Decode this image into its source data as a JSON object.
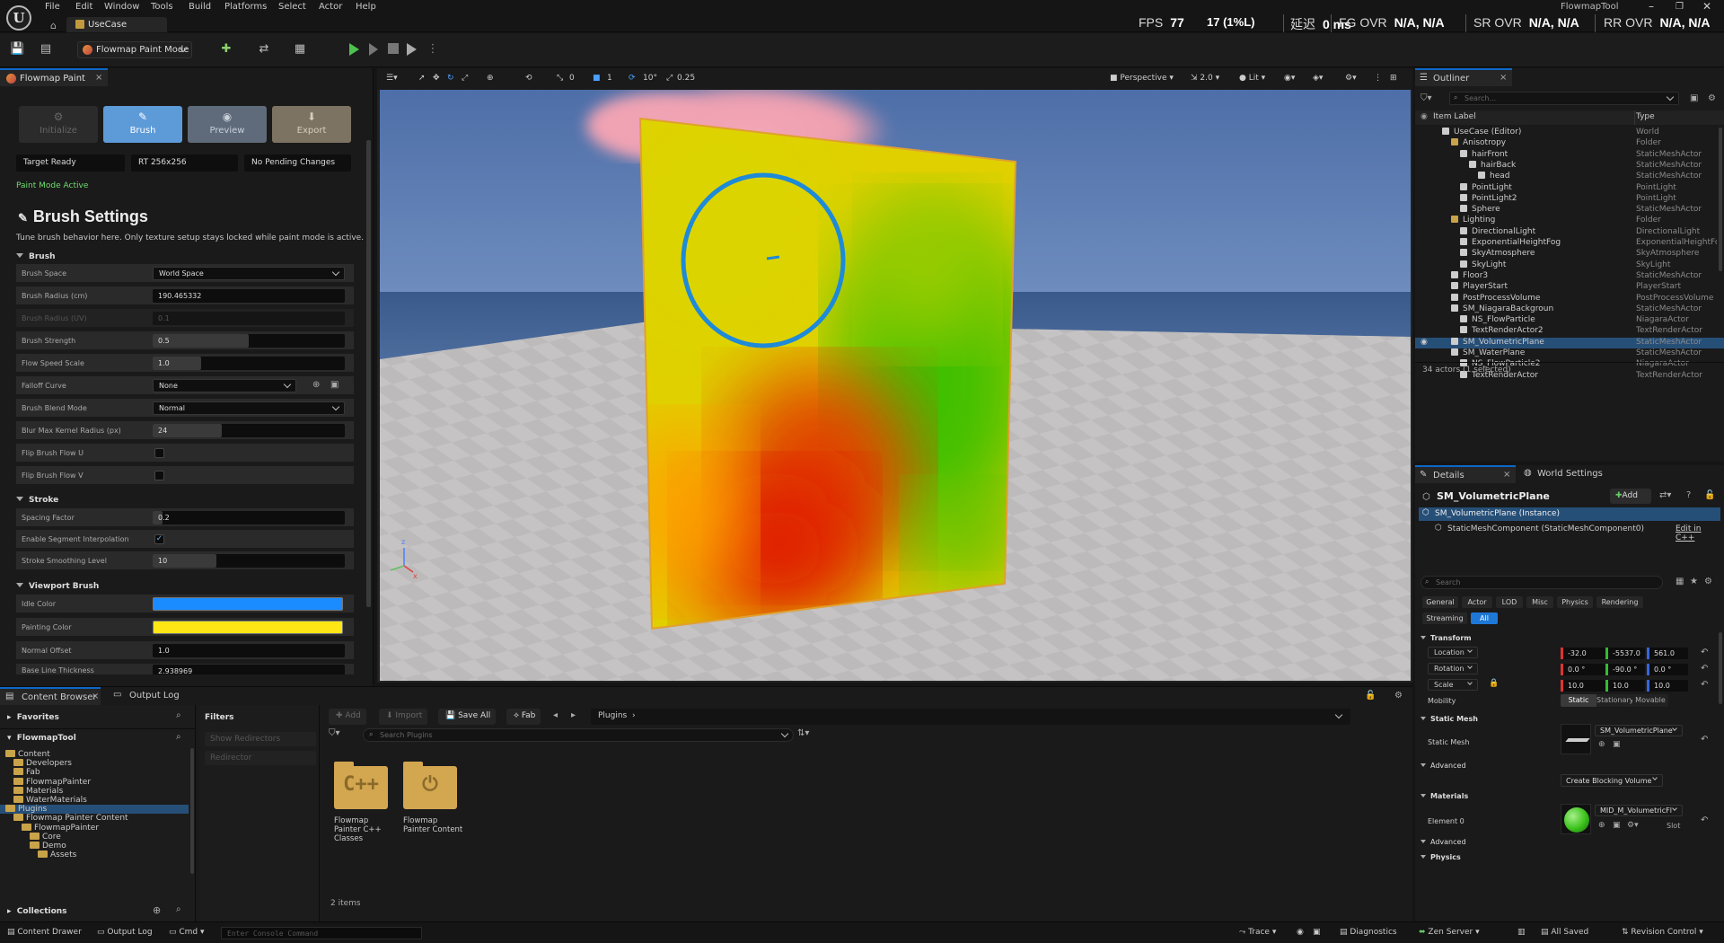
{
  "menu": [
    "File",
    "Edit",
    "Window",
    "Tools",
    "Build",
    "Platforms",
    "Select",
    "Actor",
    "Help"
  ],
  "doc_tab": "UseCase",
  "project_name": "FlowmapTool",
  "stats": {
    "fps_label": "FPS",
    "fps": "77",
    "ms": "17 (1%L)",
    "latency_label": "延迟",
    "latency": "0 ms",
    "fg_label": "FG OVR",
    "fg": "N/A, N/A",
    "sr_label": "SR OVR",
    "sr": "N/A, N/A",
    "rr_label": "RR OVR",
    "rr": "N/A, N/A"
  },
  "toolbar": {
    "mode": "Flowmap Paint Mode"
  },
  "left_panel": {
    "tab": "Flowmap Paint",
    "modes": [
      {
        "label": "Initialize",
        "glyph": "⚙"
      },
      {
        "label": "Brush",
        "glyph": "✎"
      },
      {
        "label": "Preview",
        "glyph": "◉"
      },
      {
        "label": "Export",
        "glyph": "⬇"
      }
    ],
    "pills": [
      "Target Ready",
      "RT 256x256",
      "No Pending Changes"
    ],
    "status": "Paint Mode Active",
    "title": "Brush Settings",
    "desc": "Tune brush behavior here. Only texture setup stays locked while paint mode is active.",
    "sections": {
      "brush": "Brush",
      "stroke": "Stroke",
      "viewport": "Viewport Brush"
    },
    "rows": {
      "brush_space": {
        "label": "Brush Space",
        "value": "World Space"
      },
      "brush_radius": {
        "label": "Brush Radius (cm)",
        "value": "190.465332"
      },
      "brush_radius_uv": {
        "label": "Brush Radius (UV)",
        "value": "0.1"
      },
      "brush_strength": {
        "label": "Brush Strength",
        "value": "0.5",
        "fill": 0.5
      },
      "flow_speed": {
        "label": "Flow Speed Scale",
        "value": "1.0",
        "fill": 0.25
      },
      "falloff": {
        "label": "Falloff Curve",
        "value": "None"
      },
      "blend": {
        "label": "Brush Blend Mode",
        "value": "Normal"
      },
      "blur": {
        "label": "Blur Max Kernel Radius (px)",
        "value": "24",
        "fill": 0.36
      },
      "flip_u": {
        "label": "Flip Brush Flow U",
        "checked": false
      },
      "flip_v": {
        "label": "Flip Brush Flow V",
        "checked": false
      },
      "spacing": {
        "label": "Spacing Factor",
        "value": "0.2",
        "fill": 0.05
      },
      "segment": {
        "label": "Enable Segment Interpolation",
        "checked": true
      },
      "smoothing": {
        "label": "Stroke Smoothing Level",
        "value": "10",
        "fill": 0.33
      },
      "idle_color": {
        "label": "Idle Color",
        "color": "#1a8cff"
      },
      "paint_color": {
        "label": "Painting Color",
        "color": "#ffe614"
      },
      "normal_offset": {
        "label": "Normal Offset",
        "value": "1.0"
      },
      "line_thickness": {
        "label": "Base Line Thickness",
        "value": "2.938969"
      }
    }
  },
  "viewport": {
    "perspective": "Perspective",
    "lit": "Lit",
    "grid_vals": [
      "0",
      "1",
      "10°",
      "0.25"
    ],
    "cam_speed": "2.0"
  },
  "outliner": {
    "tab": "Outliner",
    "search": "Search...",
    "col_label": "Item Label",
    "col_type": "Type",
    "items": [
      {
        "name": "UseCase (Editor)",
        "type": "World",
        "indent": 0
      },
      {
        "name": "Anisotropy",
        "type": "Folder",
        "indent": 1
      },
      {
        "name": "hairFront",
        "type": "StaticMeshActor",
        "indent": 2
      },
      {
        "name": "hairBack",
        "type": "StaticMeshActor",
        "indent": 3
      },
      {
        "name": "head",
        "type": "StaticMeshActor",
        "indent": 4
      },
      {
        "name": "PointLight",
        "type": "PointLight",
        "indent": 2
      },
      {
        "name": "PointLight2",
        "type": "PointLight",
        "indent": 2
      },
      {
        "name": "Sphere",
        "type": "StaticMeshActor",
        "indent": 2
      },
      {
        "name": "Lighting",
        "type": "Folder",
        "indent": 1
      },
      {
        "name": "DirectionalLight",
        "type": "DirectionalLight",
        "indent": 2
      },
      {
        "name": "ExponentialHeightFog",
        "type": "ExponentialHeightFog",
        "indent": 2
      },
      {
        "name": "SkyAtmosphere",
        "type": "SkyAtmosphere",
        "indent": 2
      },
      {
        "name": "SkyLight",
        "type": "SkyLight",
        "indent": 2
      },
      {
        "name": "Floor3",
        "type": "StaticMeshActor",
        "indent": 1
      },
      {
        "name": "PlayerStart",
        "type": "PlayerStart",
        "indent": 1
      },
      {
        "name": "PostProcessVolume",
        "type": "PostProcessVolume",
        "indent": 1
      },
      {
        "name": "SM_NiagaraBackgroun",
        "type": "StaticMeshActor",
        "indent": 1
      },
      {
        "name": "NS_FlowParticle",
        "type": "NiagaraActor",
        "indent": 2
      },
      {
        "name": "TextRenderActor2",
        "type": "TextRenderActor",
        "indent": 2
      },
      {
        "name": "SM_VolumetricPlane",
        "type": "StaticMeshActor",
        "indent": 1,
        "selected": true
      },
      {
        "name": "SM_WaterPlane",
        "type": "StaticMeshActor",
        "indent": 1
      },
      {
        "name": "NS_FlowParticle2",
        "type": "NiagaraActor",
        "indent": 2
      },
      {
        "name": "TextRenderActor",
        "type": "TextRenderActor",
        "indent": 2
      }
    ],
    "count": "34 actors (1 selected)"
  },
  "details": {
    "tab": "Details",
    "tab2": "World Settings",
    "actor": "SM_VolumetricPlane",
    "add": "Add",
    "instance": "SM_VolumetricPlane (Instance)",
    "component": "StaticMeshComponent (StaticMeshComponent0)",
    "edit_cpp": "Edit in C++",
    "search": "Search",
    "filters": [
      "General",
      "Actor",
      "LOD",
      "Misc",
      "Physics",
      "Rendering",
      "Streaming",
      "All"
    ],
    "transform": "Transform",
    "location_label": "Location",
    "location": [
      "-32.0",
      "-5537.0",
      "561.0"
    ],
    "rotation_label": "Rotation",
    "rotation": [
      "0.0 °",
      "-90.0 °",
      "0.0 °"
    ],
    "scale_label": "Scale",
    "scale": [
      "10.0",
      "10.0",
      "10.0"
    ],
    "mobility_label": "Mobility",
    "mobility": [
      "Static",
      "Stationary",
      "Movable"
    ],
    "static_mesh_sec": "Static Mesh",
    "static_mesh_label": "Static Mesh",
    "static_mesh": "SM_VolumetricPlane",
    "advanced": "Advanced",
    "blocking": "Create Blocking Volume",
    "materials_sec": "Materials",
    "element": "Element 0",
    "material": "MID_M_VolumetricFl",
    "slot": "Slot",
    "advanced2": "Advanced",
    "physics": "Physics"
  },
  "content_browser": {
    "tab": "Content Browser",
    "tab2": "Output Log",
    "favorites": "Favorites",
    "project": "FlowmapTool",
    "tree": [
      {
        "name": "Content",
        "indent": 0
      },
      {
        "name": "Developers",
        "indent": 1
      },
      {
        "name": "Fab",
        "indent": 1
      },
      {
        "name": "FlowmapPainter",
        "indent": 1
      },
      {
        "name": "Materials",
        "indent": 1
      },
      {
        "name": "WaterMaterials",
        "indent": 1
      },
      {
        "name": "Plugins",
        "indent": 0,
        "selected": true
      },
      {
        "name": "Flowmap Painter Content",
        "indent": 1
      },
      {
        "name": "FlowmapPainter",
        "indent": 2
      },
      {
        "name": "Core",
        "indent": 3
      },
      {
        "name": "Demo",
        "indent": 3
      },
      {
        "name": "Assets",
        "indent": 4
      }
    ],
    "collections": "Collections",
    "filters_title": "Filters",
    "filter_items": [
      "Show Redirectors",
      "Redirector"
    ],
    "add": "Add",
    "import": "Import",
    "save_all": "Save All",
    "fab": "Fab",
    "path": "Plugins",
    "search": "Search Plugins",
    "items": [
      {
        "label": "Flowmap Painter C++ Classes",
        "sym": "C++"
      },
      {
        "label": "Flowmap Painter Content",
        "sym": "⏻"
      }
    ],
    "count": "2 items"
  },
  "statusbar": {
    "drawer": "Content Drawer",
    "output": "Output Log",
    "cmd": "Cmd",
    "console": "Enter Console Command",
    "trace": "Trace",
    "diagnostics": "Diagnostics",
    "zen": "Zen Server",
    "saved": "All Saved",
    "revision": "Revision Control"
  },
  "colors": {
    "accent": "#0d68c9",
    "brush_ring": "#1e8ad8",
    "selection": "#264f78"
  }
}
